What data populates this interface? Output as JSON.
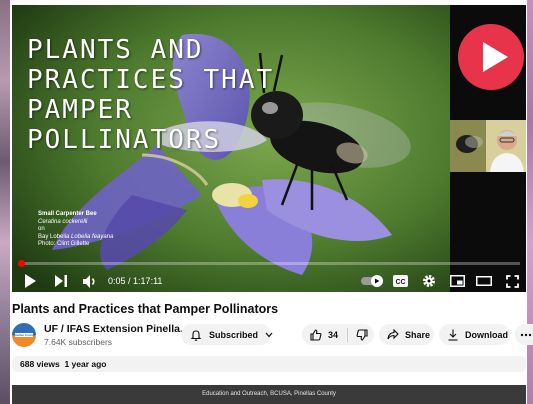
{
  "video": {
    "overlay_title": "PLANTS AND PRACTICES THAT PAMPER POLLINATORS",
    "caption": {
      "line1": "Small Carpenter Bee",
      "line2": "Ceratina cockerelli",
      "line3": "on",
      "line4_common": "Bay Lobelia",
      "line4_latin": "Lobelia feayana",
      "line5": "Photo: Clint Gillette"
    }
  },
  "player": {
    "time_current": "0:05",
    "time_separator": " / ",
    "time_total": "1:17:11",
    "progress_fraction": 0.001
  },
  "page": {
    "title": "Plants and Practices that Pamper Pollinators",
    "channel": {
      "name": "UF / IFAS Extension Pinella...",
      "subscribers": "7.64K subscribers",
      "avatar_label": "Pinellas County"
    },
    "subscribe_label": "Subscribed",
    "like_count": "34",
    "share_label": "Share",
    "download_label": "Download",
    "views": "688 views",
    "date": "1 year ago"
  },
  "footer": {
    "text": "Education and Outreach, BCUSA, Pinellas County"
  },
  "colors": {
    "accent_red": "#ff0000",
    "logo_red": "#e8344a",
    "pill_bg": "#f2f2f2"
  }
}
